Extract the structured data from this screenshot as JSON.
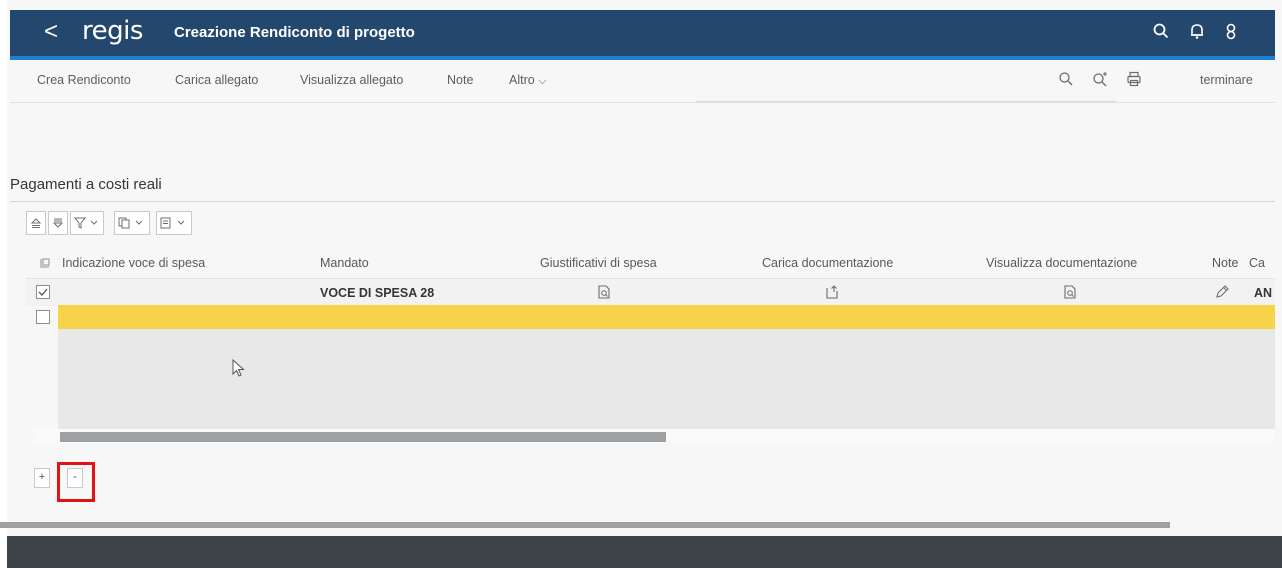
{
  "shell": {
    "back_label": "<",
    "logo_text": "regis",
    "title": "Creazione Rendiconto di progetto",
    "icons": [
      "search-icon",
      "bell-icon",
      "user-icon"
    ]
  },
  "toolbar": {
    "items": [
      "Crea Rendiconto",
      "Carica allegato",
      "Visualizza allegato",
      "Note",
      "Altro"
    ],
    "more_chevron": "⌵",
    "right_icons": [
      "search-icon",
      "zoom-in-icon",
      "print-icon"
    ],
    "exit_label": "terminare"
  },
  "section": {
    "title": "Pagamenti a costi reali"
  },
  "table": {
    "columns": [
      "Indicazione voce di spesa",
      "Mandato",
      "Giustificativi di spesa",
      "Carica documentazione",
      "Visualizza documentazione",
      "Note",
      "Ca"
    ],
    "rows": [
      {
        "checked": true,
        "indicazione": "",
        "mandato": "VOCE DI SPESA 28",
        "icons": [
          "document-search-icon",
          "upload-document-icon",
          "document-search-icon",
          "edit-note-icon"
        ],
        "last": "AN"
      },
      {
        "checked": false,
        "indicazione": "",
        "mandato": "",
        "last": ""
      }
    ]
  },
  "row_buttons": {
    "add": "+",
    "remove": "-"
  },
  "colors": {
    "shell_bg": "#24476e",
    "shell_accent": "#1f7fd1",
    "selected_row": "#f7d34a",
    "highlight_box": "#e01212",
    "footer_bg": "#3d4449"
  }
}
